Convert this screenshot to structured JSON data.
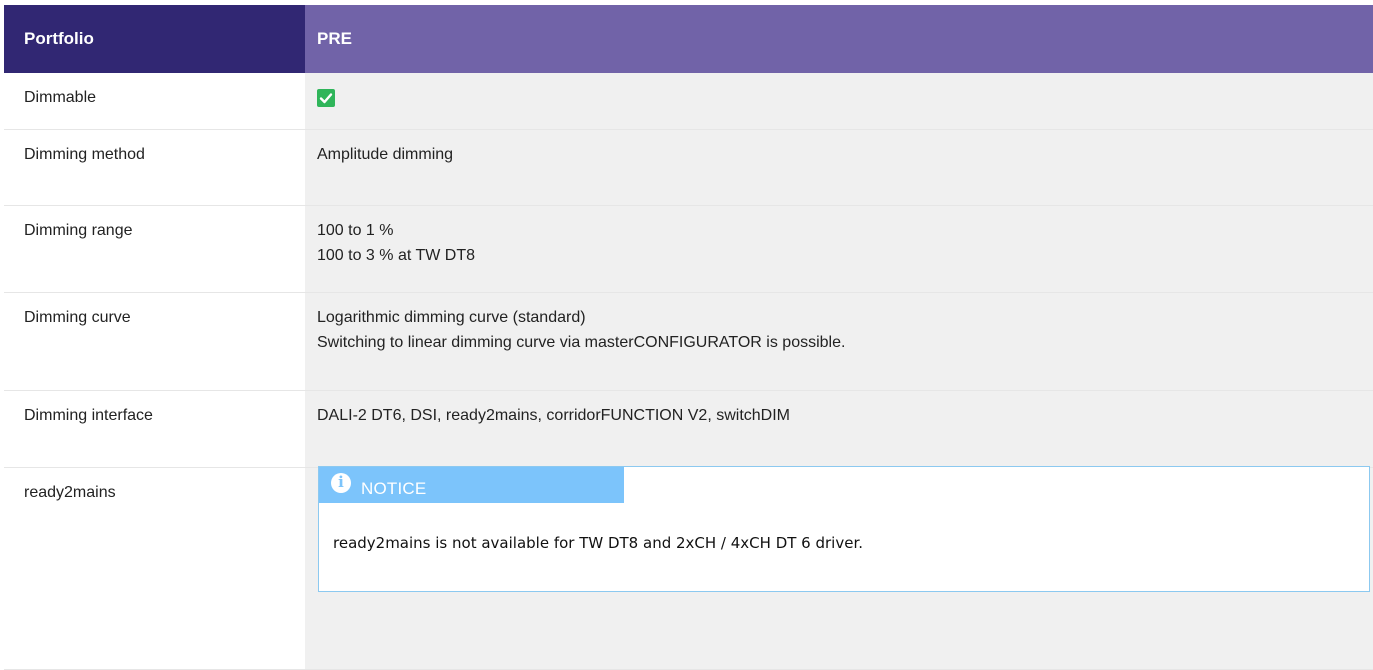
{
  "header": {
    "col1": "Portfolio",
    "col2": "PRE"
  },
  "rows": [
    {
      "label": "Dimmable",
      "checked": true,
      "icon": "checkmark-icon",
      "icon_color": "#2fb55a"
    },
    {
      "label": "Dimming method",
      "lines": [
        "Amplitude dimming"
      ]
    },
    {
      "label": "Dimming range",
      "lines": [
        "100 to 1 %",
        "100 to 3 % at TW DT8"
      ]
    },
    {
      "label": "Dimming curve",
      "lines": [
        "Logarithmic dimming curve (standard)",
        "Switching to linear dimming curve via masterCONFIGURATOR is possible."
      ]
    },
    {
      "label": "Dimming interface",
      "lines": [
        "DALI-2 DT6, DSI, ready2mains, corridorFUNCTION V2, switchDIM"
      ]
    },
    {
      "label": "ready2mains",
      "notice": {
        "icon": "info-icon",
        "icon_glyph": "i",
        "title": "NOTICE",
        "text": "ready2mains is not available for TW DT8 and 2xCH / 4xCH DT 6 driver."
      }
    }
  ],
  "colors": {
    "header_dark": "#312773",
    "header_light": "#7163a8",
    "value_bg": "#f0f0f0",
    "notice_bg": "#7cc4fb",
    "notice_border": "#8cc9f0"
  }
}
